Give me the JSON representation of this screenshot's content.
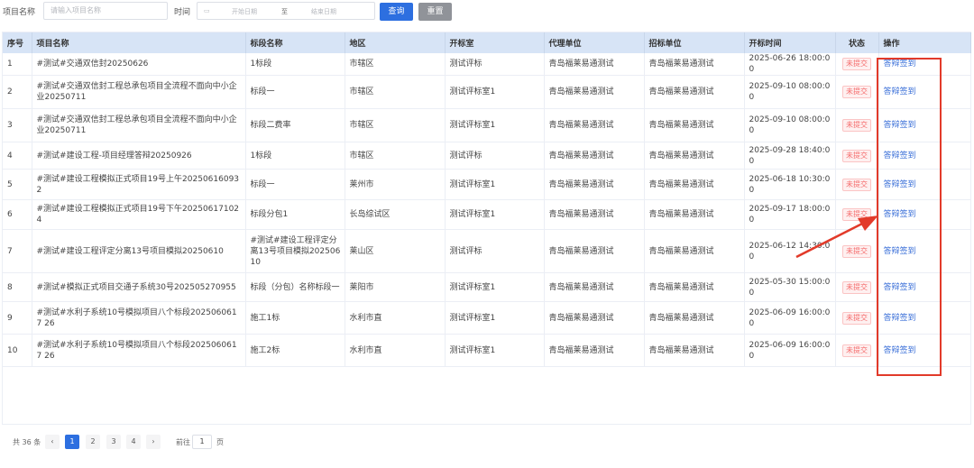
{
  "search": {
    "project_label": "项目名称",
    "project_placeholder": "请输入项目名称",
    "time_label": "时间",
    "start_placeholder": "开始日期",
    "range_sep": "至",
    "end_placeholder": "结束日期",
    "query_button": "查询",
    "reset_button": "重置"
  },
  "table": {
    "headers": [
      "序号",
      "项目名称",
      "标段名称",
      "地区",
      "开标室",
      "代理单位",
      "招标单位",
      "开标时间",
      "状态",
      "操作"
    ],
    "rows": [
      {
        "no": "1",
        "project": "#测试#交通双信封20250626",
        "section": "1标段",
        "region": "市辖区",
        "room": "测试评标",
        "agent": "青岛福莱易通测试",
        "tenderer": "青岛福莱易通测试",
        "time": "2025-06-26 18:00:00",
        "status": "未提交",
        "action": "答辩签到"
      },
      {
        "no": "2",
        "project": "#测试#交通双信封工程总承包项目全流程不面向中小企业20250711",
        "section": "标段一",
        "region": "市辖区",
        "room": "测试评标室1",
        "agent": "青岛福莱易通测试",
        "tenderer": "青岛福莱易通测试",
        "time": "2025-09-10 08:00:00",
        "status": "未提交",
        "action": "答辩签到"
      },
      {
        "no": "3",
        "project": "#测试#交通双信封工程总承包项目全流程不面向中小企业20250711",
        "section": "标段二费率",
        "region": "市辖区",
        "room": "测试评标室1",
        "agent": "青岛福莱易通测试",
        "tenderer": "青岛福莱易通测试",
        "time": "2025-09-10 08:00:00",
        "status": "未提交",
        "action": "答辩签到"
      },
      {
        "no": "4",
        "project": "#测试#建设工程-项目经理答辩20250926",
        "section": "1标段",
        "region": "市辖区",
        "room": "测试评标",
        "agent": "青岛福莱易通测试",
        "tenderer": "青岛福莱易通测试",
        "time": "2025-09-28 18:40:00",
        "status": "未提交",
        "action": "答辩签到"
      },
      {
        "no": "5",
        "project": "#测试#建设工程模拟正式项目19号上午202506160932",
        "section": "标段一",
        "region": "莱州市",
        "room": "测试评标室1",
        "agent": "青岛福莱易通测试",
        "tenderer": "青岛福莱易通测试",
        "time": "2025-06-18 10:30:00",
        "status": "未提交",
        "action": "答辩签到"
      },
      {
        "no": "6",
        "project": "#测试#建设工程模拟正式项目19号下午202506171024",
        "section": "标段分包1",
        "region": "长岛综试区",
        "room": "测试评标室1",
        "agent": "青岛福莱易通测试",
        "tenderer": "青岛福莱易通测试",
        "time": "2025-09-17 18:00:00",
        "status": "未提交",
        "action": "答辩签到"
      },
      {
        "no": "7",
        "project": "#测试#建设工程评定分离13号项目模拟20250610",
        "section": "#测试#建设工程评定分离13号项目模拟20250610",
        "region": "莱山区",
        "room": "测试评标",
        "agent": "青岛福莱易通测试",
        "tenderer": "青岛福莱易通测试",
        "time": "2025-06-12 14:30:00",
        "status": "未提交",
        "action": "答辩签到"
      },
      {
        "no": "8",
        "project": "#测试#模拟正式项目交通子系统30号202505270955",
        "section": "标段（分包）名称标段一",
        "region": "莱阳市",
        "room": "测试评标室1",
        "agent": "青岛福莱易通测试",
        "tenderer": "青岛福莱易通测试",
        "time": "2025-05-30 15:00:00",
        "status": "未提交",
        "action": "答辩签到"
      },
      {
        "no": "9",
        "project": "#测试#水利子系统10号模拟项目八个标段2025060617 26",
        "section": "施工1标",
        "region": "水利市直",
        "room": "测试评标室1",
        "agent": "青岛福莱易通测试",
        "tenderer": "青岛福莱易通测试",
        "time": "2025-06-09 16:00:00",
        "status": "未提交",
        "action": "答辩签到"
      },
      {
        "no": "10",
        "project": "#测试#水利子系统10号模拟项目八个标段2025060617 26",
        "section": "施工2标",
        "region": "水利市直",
        "room": "测试评标室1",
        "agent": "青岛福莱易通测试",
        "tenderer": "青岛福莱易通测试",
        "time": "2025-06-09 16:00:00",
        "status": "未提交",
        "action": "答辩签到"
      }
    ]
  },
  "pagination": {
    "total_text": "共 36 条",
    "prev": "‹",
    "pages": [
      "1",
      "2",
      "3",
      "4"
    ],
    "next": "›",
    "goto_label": "前往",
    "goto_value": "1",
    "goto_unit": "页"
  },
  "annotation": {
    "color": "#e23a2a"
  }
}
